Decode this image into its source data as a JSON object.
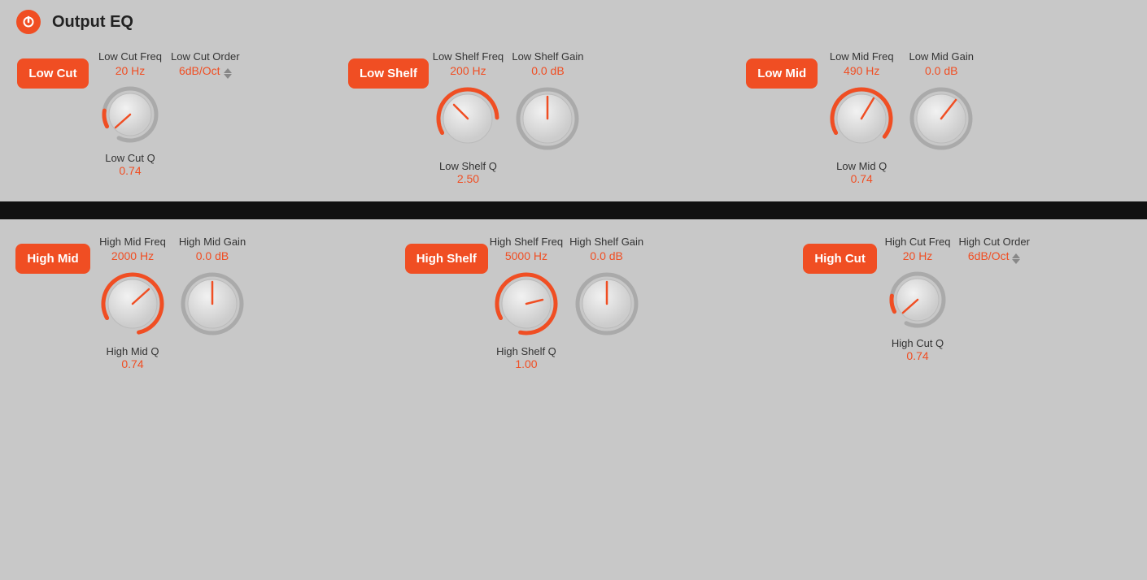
{
  "app": {
    "title": "Output EQ"
  },
  "top": {
    "bands": [
      {
        "id": "low-cut",
        "label": "Low Cut",
        "params": [
          {
            "id": "freq",
            "label": "Low Cut Freq",
            "value": "20 Hz",
            "type": "knob",
            "rotation": -120
          },
          {
            "id": "order",
            "label": "Low Cut Order",
            "value": "6dB/Oct",
            "type": "stepper"
          }
        ],
        "q": {
          "label": "Low Cut Q",
          "value": "0.74"
        }
      },
      {
        "id": "low-shelf",
        "label": "Low Shelf",
        "params": [
          {
            "id": "freq",
            "label": "Low Shelf Freq",
            "value": "200 Hz",
            "type": "knob",
            "rotation": -80
          },
          {
            "id": "gain",
            "label": "Low Shelf Gain",
            "value": "0.0 dB",
            "type": "knob",
            "rotation": 0
          }
        ],
        "q": {
          "label": "Low Shelf Q",
          "value": "2.50"
        }
      },
      {
        "id": "low-mid",
        "label": "Low Mid",
        "params": [
          {
            "id": "freq",
            "label": "Low Mid Freq",
            "value": "490 Hz",
            "type": "knob",
            "rotation": -50
          },
          {
            "id": "gain",
            "label": "Low Mid Gain",
            "value": "0.0 dB",
            "type": "knob",
            "rotation": 0
          }
        ],
        "q": {
          "label": "Low Mid Q",
          "value": "0.74"
        }
      }
    ]
  },
  "bottom": {
    "bands": [
      {
        "id": "high-mid",
        "label": "High Mid",
        "params": [
          {
            "id": "freq",
            "label": "High Mid Freq",
            "value": "2000 Hz",
            "type": "knob",
            "rotation": -30
          },
          {
            "id": "gain",
            "label": "High Mid Gain",
            "value": "0.0 dB",
            "type": "knob",
            "rotation": 0
          }
        ],
        "q": {
          "label": "High Mid Q",
          "value": "0.74"
        }
      },
      {
        "id": "high-shelf",
        "label": "High Shelf",
        "params": [
          {
            "id": "freq",
            "label": "High Shelf Freq",
            "value": "5000 Hz",
            "type": "knob",
            "rotation": 20
          },
          {
            "id": "gain",
            "label": "High Shelf Gain",
            "value": "0.0 dB",
            "type": "knob",
            "rotation": 0
          }
        ],
        "q": {
          "label": "High Shelf Q",
          "value": "1.00"
        }
      },
      {
        "id": "high-cut",
        "label": "High Cut",
        "params": [
          {
            "id": "freq",
            "label": "High Cut Freq",
            "value": "20 Hz",
            "type": "knob",
            "rotation": -120
          },
          {
            "id": "order",
            "label": "High Cut Order",
            "value": "6dB/Oct",
            "type": "stepper"
          }
        ],
        "q": {
          "label": "High Cut Q",
          "value": "0.74"
        }
      }
    ]
  },
  "icons": {
    "power": "power-icon"
  }
}
